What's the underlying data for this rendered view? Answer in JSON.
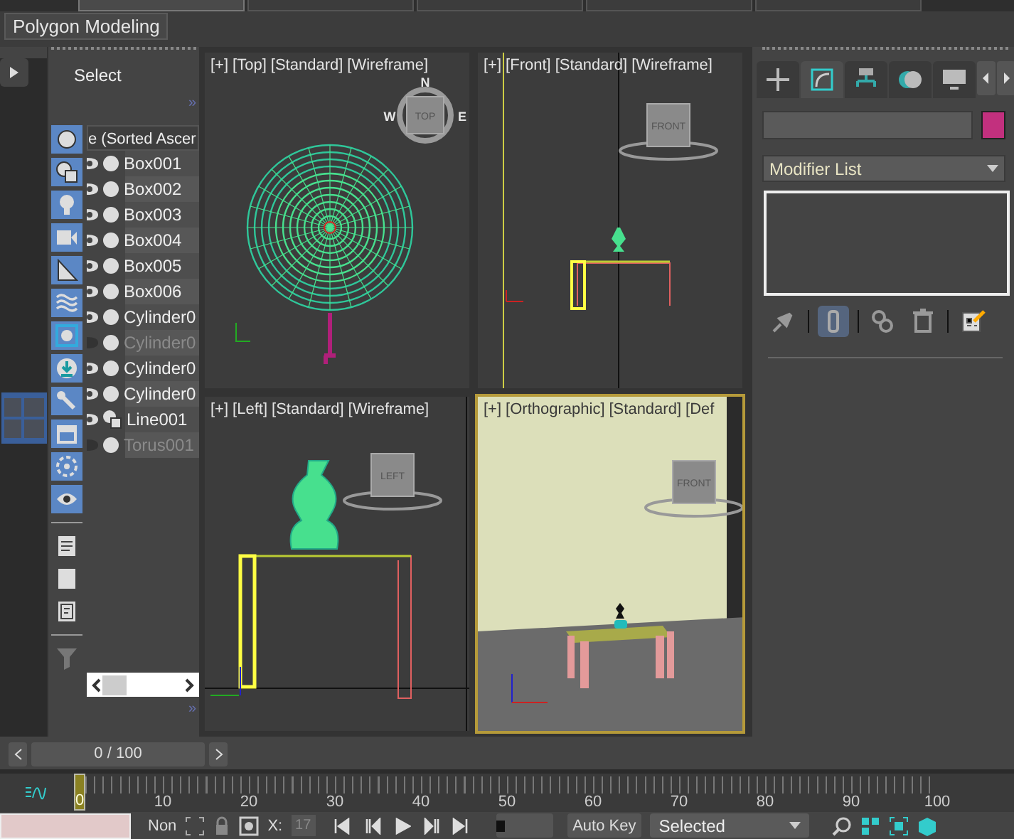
{
  "ribbon": {
    "tabs": [
      {
        "selected": true
      },
      {
        "selected": false
      },
      {
        "selected": false
      },
      {
        "selected": false
      },
      {
        "selected": false
      }
    ],
    "panel_button": "Polygon Modeling"
  },
  "explorer": {
    "title": "Select",
    "more_top": "»",
    "more_bottom": "»",
    "column_header": "e (Sorted Ascer",
    "items": [
      {
        "name": "Box001",
        "kind": "object",
        "hidden": false
      },
      {
        "name": "Box002",
        "kind": "object",
        "hidden": false
      },
      {
        "name": "Box003",
        "kind": "object",
        "hidden": false
      },
      {
        "name": "Box004",
        "kind": "object",
        "hidden": false
      },
      {
        "name": "Box005",
        "kind": "object",
        "hidden": false
      },
      {
        "name": "Box006",
        "kind": "object",
        "hidden": false
      },
      {
        "name": "Cylinder0",
        "kind": "object",
        "hidden": false
      },
      {
        "name": "Cylinder0",
        "kind": "object",
        "hidden": true
      },
      {
        "name": "Cylinder0",
        "kind": "object",
        "hidden": false
      },
      {
        "name": "Cylinder0",
        "kind": "object",
        "hidden": false
      },
      {
        "name": "Line001",
        "kind": "shape",
        "hidden": false
      },
      {
        "name": "Torus001",
        "kind": "object",
        "hidden": true
      }
    ]
  },
  "viewports": [
    {
      "kind": "top",
      "labels": [
        "[+]",
        "[Top]",
        "[Standard]",
        "[Wireframe]"
      ],
      "active": false,
      "viewcube": "TOP",
      "compass": [
        "N",
        "W",
        "E"
      ]
    },
    {
      "kind": "front",
      "labels": [
        "[+]",
        "[Front]",
        "[Standard]",
        "[Wireframe]"
      ],
      "active": false,
      "viewcube": "FRONT"
    },
    {
      "kind": "left",
      "labels": [
        "[+]",
        "[Left]",
        "[Standard]",
        "[Wireframe]"
      ],
      "active": false,
      "viewcube": "LEFT"
    },
    {
      "kind": "ortho",
      "labels": [
        "[+]",
        "[Orthographic]",
        "[Standard]",
        "[Def"
      ],
      "active": true,
      "viewcube": "FRONT"
    }
  ],
  "command_panel": {
    "tabs": [
      {
        "selected": false
      },
      {
        "selected": true
      },
      {
        "selected": false
      },
      {
        "selected": false
      },
      {
        "selected": false
      }
    ],
    "modifier_list": "Modifier List",
    "stack_buttons": [
      {
        "on": false
      },
      {
        "on": true
      },
      {
        "on": false
      },
      {
        "on": false
      },
      {
        "on": false
      }
    ]
  },
  "time_slider": {
    "reading": "0 / 100",
    "level": 0
  },
  "track_bar": {
    "current": "0",
    "ticks": [
      "10",
      "20",
      "30",
      "40",
      "50",
      "60",
      "70",
      "80",
      "90",
      "100"
    ]
  },
  "status_bar": {
    "selection": "Non",
    "x_label": "X:",
    "x_value": "17",
    "key_mode": "Auto Key",
    "key_filter": "Selected"
  }
}
